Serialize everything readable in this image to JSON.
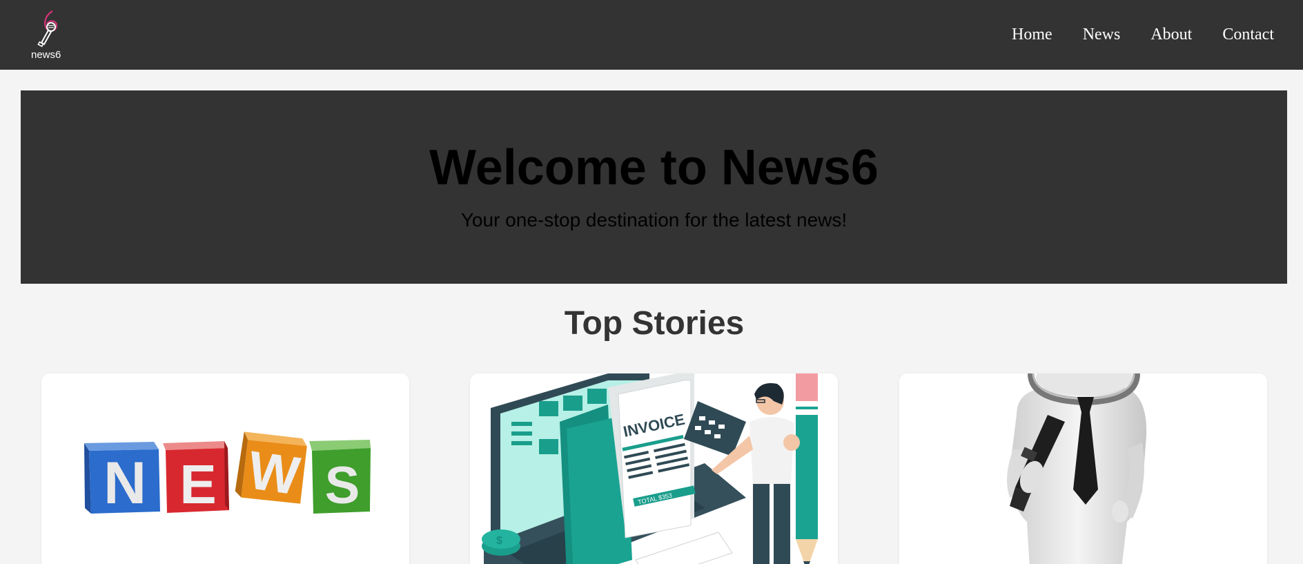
{
  "brand": {
    "logo_text": "news6"
  },
  "nav": {
    "items": [
      {
        "label": "Home"
      },
      {
        "label": "News"
      },
      {
        "label": "About"
      },
      {
        "label": "Contact"
      }
    ]
  },
  "hero": {
    "title": "Welcome to News6",
    "subtitle": "Your one-stop destination for the latest news!"
  },
  "top_stories": {
    "title": "Top Stories",
    "cards": [
      {
        "image": "news-cubes-image",
        "letters": [
          "N",
          "E",
          "W",
          "S"
        ]
      },
      {
        "image": "invoice-illustration-image",
        "invoice_text": "INVOICE",
        "total_text": "TOTAL $353"
      },
      {
        "image": "magnifier-person-image"
      }
    ]
  },
  "colors": {
    "nav_bg": "#333333",
    "page_bg": "#f4f4f4",
    "accent_pink": "#d6337a",
    "teal": "#1a9e8c"
  }
}
